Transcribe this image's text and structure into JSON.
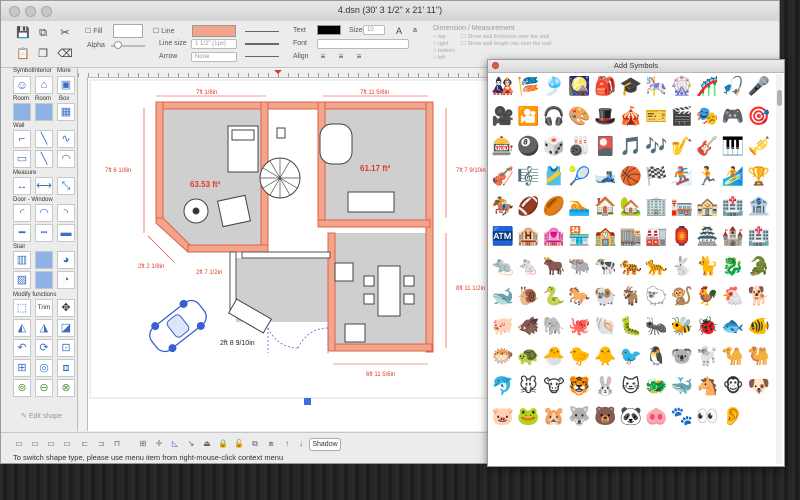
{
  "window": {
    "title": "4.dsn (30' 3 1/2\" x 21' 11\")"
  },
  "toolbar": {
    "fill_label": "Fill",
    "alpha_label": "Alpha",
    "line_label": "Line",
    "line_size_label": "Line size",
    "line_size_value": "1 1/2\" (1px)",
    "arrow_label": "Arrow",
    "arrow_value": "None",
    "text_label": "Text",
    "size_label": "Size",
    "size_value": "10",
    "font_label": "Font",
    "align_label": "Align",
    "dimension_header": "Dimension / Measurement",
    "dim_options": [
      "top",
      "right",
      "bottom",
      "left"
    ],
    "dim_checks": [
      "Show wall thickness over the wall",
      "Show wall length into over the wall"
    ],
    "fill_color": "#f2a58a",
    "text_color": "#000000"
  },
  "sidebar": {
    "symbol_label": "Symbol",
    "interior_label": "Interior",
    "more_label": "More",
    "room_label": "Room",
    "box_label": "Box",
    "wall_label": "Wall",
    "measure_label": "Measure",
    "door_label": "Door - Window",
    "stair_label": "Stair",
    "modify_label": "Modify functions",
    "trim_label": "Trim",
    "edit_shape_label": "Edit shape"
  },
  "plan": {
    "dim_top_left": "7ft 1/8in",
    "dim_top_right": "7ft 11 5/8in",
    "dim_left": "7ft 6 1/8in",
    "dim_right_top": "7ft 7 9/10in",
    "dim_right_bottom": "8ft 11 1/2in",
    "dim_bottom": "6ft 11 5/8in",
    "dim_diag": "2ft 2 1/8in",
    "dim_small": "2ft 7 1/2in",
    "area_left": "63.53 ft²",
    "area_right": "61.17 ft²",
    "door_label": "2ft 8 9/10in",
    "wall_color": "#f2a58a",
    "wall_edge": "#e0604a",
    "room_fill": "#cfcfcf"
  },
  "status": {
    "hint": "To switch shape type, please use menu item from right-mouse-click context menu",
    "shadow_label": "Shadow"
  },
  "symbols_panel": {
    "title": "Add Symbols",
    "symbols": [
      "🎎",
      "🎏",
      "🎐",
      "🎑",
      "🎒",
      "🎓",
      "🎠",
      "🎡",
      "🎢",
      "🎣",
      "🎤",
      "🎥",
      "🎦",
      "🎧",
      "🎨",
      "🎩",
      "🎪",
      "🎫",
      "🎬",
      "🎭",
      "🎮",
      "🎯",
      "🎰",
      "🎱",
      "🎲",
      "🎳",
      "🎴",
      "🎵",
      "🎶",
      "🎷",
      "🎸",
      "🎹",
      "🎺",
      "🎻",
      "🎼",
      "🎽",
      "🎾",
      "🎿",
      "🏀",
      "🏁",
      "🏂",
      "🏃",
      "🏄",
      "🏆",
      "🏇",
      "🏈",
      "🏉",
      "🏊",
      "🏠",
      "🏡",
      "🏢",
      "🏣",
      "🏤",
      "🏥",
      "🏦",
      "🏧",
      "🏨",
      "🏩",
      "🏪",
      "🏫",
      "🏬",
      "🏭",
      "🏮",
      "🏯",
      "🏰",
      "🏥",
      "🐀",
      "🐁",
      "🐂",
      "🐃",
      "🐄",
      "🐅",
      "🐆",
      "🐇",
      "🐈",
      "🐉",
      "🐊",
      "🐋",
      "🐌",
      "🐍",
      "🐎",
      "🐏",
      "🐐",
      "🐑",
      "🐒",
      "🐓",
      "🐔",
      "🐕",
      "🐖",
      "🐗",
      "🐘",
      "🐙",
      "🐚",
      "🐛",
      "🐜",
      "🐝",
      "🐞",
      "🐟",
      "🐠",
      "🐡",
      "🐢",
      "🐣",
      "🐤",
      "🐥",
      "🐦",
      "🐧",
      "🐨",
      "🐩",
      "🐪",
      "🐫",
      "🐬",
      "🐭",
      "🐮",
      "🐯",
      "🐰",
      "🐱",
      "🐲",
      "🐳",
      "🐴",
      "🐵",
      "🐶",
      "🐷",
      "🐸",
      "🐹",
      "🐺",
      "🐻",
      "🐼",
      "🐽",
      "🐾",
      "👀",
      "👂"
    ]
  }
}
